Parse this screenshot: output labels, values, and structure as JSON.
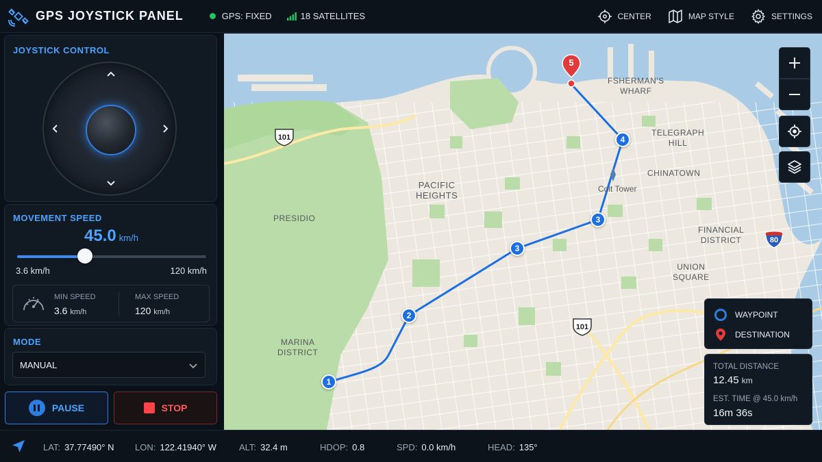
{
  "header": {
    "title": "GPS JOYSTICK PANEL",
    "gps_status": "GPS: FIXED",
    "satellites": "18 SATELLITES",
    "actions": {
      "center": "CENTER",
      "map_style": "MAP STYLE",
      "settings": "SETTINGS"
    },
    "status_color": "#22c55e"
  },
  "joystick": {
    "title": "JOYSTICK CONTROL"
  },
  "speed": {
    "title": "MOVEMENT SPEED",
    "value": "45.0",
    "unit": "km/h",
    "slider_fraction": 0.36,
    "range_min": "3.6 km/h",
    "range_max": "120 km/h",
    "min_label": "MIN SPEED",
    "min_value": "3.6",
    "min_unit": "km/h",
    "max_label": "MAX SPEED",
    "max_value": "120",
    "max_unit": "km/h"
  },
  "mode": {
    "title": "MODE",
    "selected": "MANUAL"
  },
  "controls": {
    "pause": "PAUSE",
    "stop": "STOP"
  },
  "map": {
    "labels": {
      "fisherman": "FSHERMAN'S\nWHARF",
      "telegraph": "TELEGRAPH\nHILL",
      "chinatown": "CHINATOWN",
      "coit": "Coit Tower",
      "pacific": "PACIFIC\nHEIGHTS",
      "presidio": "PRESIDIO",
      "financial": "FINANCIAL\nDISTRICT",
      "union": "UNION\nSQUARE",
      "marina": "MARINA\nDISTRICT"
    },
    "shields": {
      "hwy101_a": "101",
      "hwy101_b": "101",
      "i80": "80"
    },
    "waypoints": [
      "1",
      "2",
      "3",
      "3",
      "4"
    ],
    "destination": "5",
    "route_color": "#1d6fe0"
  },
  "legend": {
    "waypoint": "WAYPOINT",
    "destination": "DESTINATION"
  },
  "trip": {
    "distance_label": "TOTAL DISTANCE",
    "distance_value": "12.45",
    "distance_unit": "km",
    "time_label": "EST. TIME @ 45.0 km/h",
    "time_value": "16m 36s"
  },
  "footer": {
    "lat_label": "LAT:",
    "lat": "37.77490° N",
    "lon_label": "LON:",
    "lon": "122.41940° W",
    "alt_label": "ALT:",
    "alt": "32.4 m",
    "hdop_label": "HDOP:",
    "hdop": "0.8",
    "spd_label": "SPD:",
    "spd": "0.0 km/h",
    "head_label": "HEAD:",
    "head": "135°"
  }
}
